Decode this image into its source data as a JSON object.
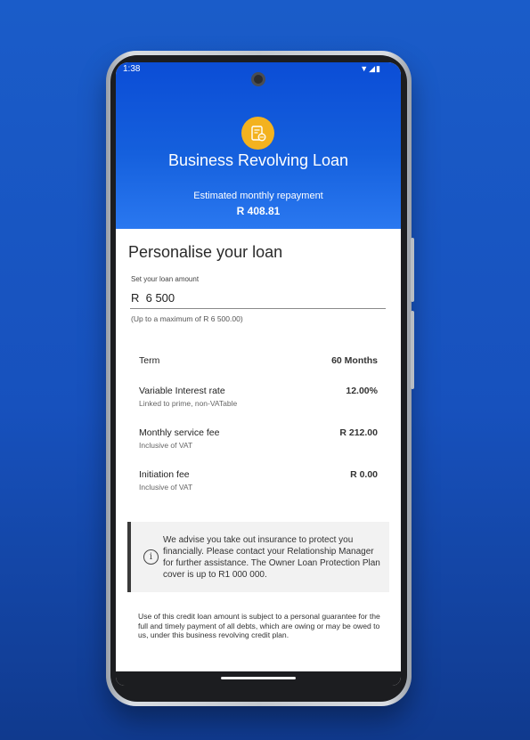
{
  "status_bar": {
    "time": "1:38",
    "icons_text": "▼◢▮"
  },
  "hero": {
    "title": "Business Revolving Loan",
    "subtitle": "Estimated monthly repayment",
    "amount": "R 408.81",
    "icon": "loan-document-coins-icon"
  },
  "form": {
    "section_title": "Personalise your loan",
    "amount_label": "Set your loan amount",
    "amount_value": "R  6 500",
    "hint": "(Up to a maximum of R 6 500.00)"
  },
  "details": [
    {
      "label": "Term",
      "sub": "",
      "value": "60 Months"
    },
    {
      "label": "Variable Interest rate",
      "sub": "Linked to prime, non-VATable",
      "value": "12.00%"
    },
    {
      "label": "Monthly service fee",
      "sub": "Inclusive of VAT",
      "value": "R 212.00"
    },
    {
      "label": "Initiation fee",
      "sub": "Inclusive of VAT",
      "value": "R 0.00"
    }
  ],
  "notice": {
    "icon": "info-icon",
    "icon_glyph": "i",
    "text": "We advise you take out insurance to protect you financially. Please contact your Relationship Manager for further assistance. The Owner Loan Protection Plan cover is up to R1 000 000."
  },
  "disclaimer": "Use of this credit loan amount is subject to a personal guarantee for the full and timely payment of all debts, which are owing or may be owed to us, under this business revolving credit plan.",
  "colors": {
    "accent_blue": "#1560dd",
    "icon_yellow": "#f3b21f",
    "background_blue": "#1a5cc9"
  }
}
